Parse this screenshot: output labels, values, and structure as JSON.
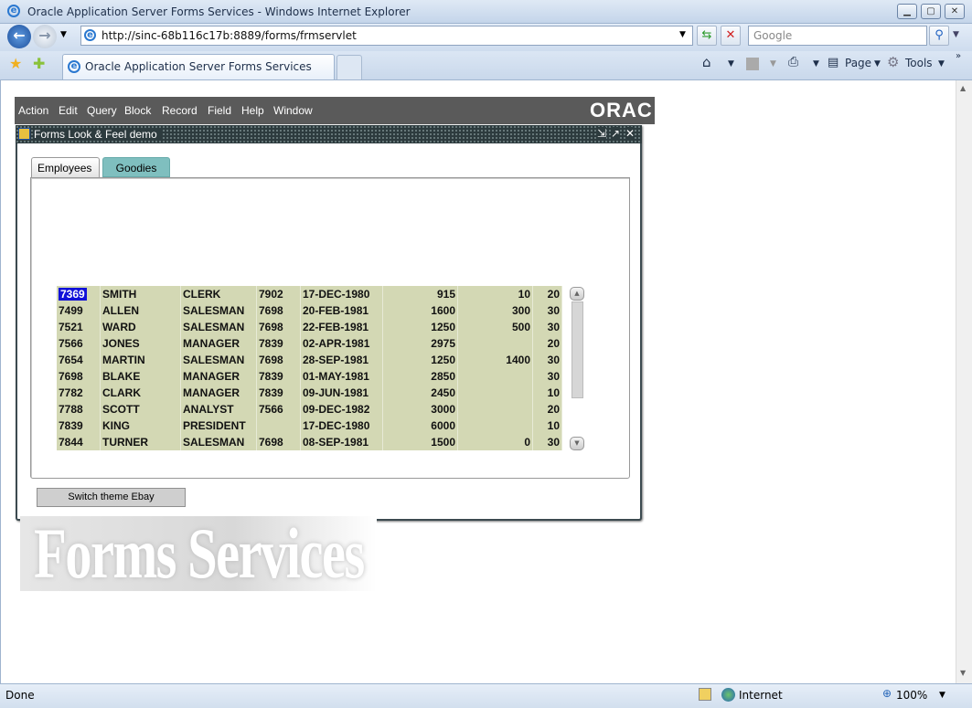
{
  "browser": {
    "window_title": "Oracle Application Server Forms Services - Windows Internet Explorer",
    "url": "http://sinc-68b116c17b:8889/forms/frmservlet",
    "search_placeholder": "Google",
    "tab_title": "Oracle Application Server Forms Services",
    "commands": {
      "page": "Page",
      "tools": "Tools"
    },
    "status": {
      "left": "Done",
      "zone": "Internet",
      "zoom": "100%"
    }
  },
  "forms": {
    "menu": [
      "Action",
      "Edit",
      "Query",
      "Block",
      "Record",
      "Field",
      "Help",
      "Window"
    ],
    "logo": "ORACLE",
    "window_title": "Forms Look & Feel demo",
    "tabs": [
      {
        "label": "Employees",
        "active": true
      },
      {
        "label": "Goodies",
        "active": false
      }
    ],
    "switch_button": "Switch theme Ebay",
    "watermark": "Forms Services",
    "row_color": "#d3d8b4",
    "selection_color": "#1010d8",
    "employees": [
      [
        "7369",
        "SMITH",
        "CLERK",
        "7902",
        "17-DEC-1980",
        "915",
        "10",
        "20"
      ],
      [
        "7499",
        "ALLEN",
        "SALESMAN",
        "7698",
        "20-FEB-1981",
        "1600",
        "300",
        "30"
      ],
      [
        "7521",
        "WARD",
        "SALESMAN",
        "7698",
        "22-FEB-1981",
        "1250",
        "500",
        "30"
      ],
      [
        "7566",
        "JONES",
        "MANAGER",
        "7839",
        "02-APR-1981",
        "2975",
        "",
        "20"
      ],
      [
        "7654",
        "MARTIN",
        "SALESMAN",
        "7698",
        "28-SEP-1981",
        "1250",
        "1400",
        "30"
      ],
      [
        "7698",
        "BLAKE",
        "MANAGER",
        "7839",
        "01-MAY-1981",
        "2850",
        "",
        "30"
      ],
      [
        "7782",
        "CLARK",
        "MANAGER",
        "7839",
        "09-JUN-1981",
        "2450",
        "",
        "10"
      ],
      [
        "7788",
        "SCOTT",
        "ANALYST",
        "7566",
        "09-DEC-1982",
        "3000",
        "",
        "20"
      ],
      [
        "7839",
        "KING",
        "PRESIDENT",
        "",
        "17-DEC-1980",
        "6000",
        "",
        "10"
      ],
      [
        "7844",
        "TURNER",
        "SALESMAN",
        "7698",
        "08-SEP-1981",
        "1500",
        "0",
        "30"
      ]
    ]
  }
}
